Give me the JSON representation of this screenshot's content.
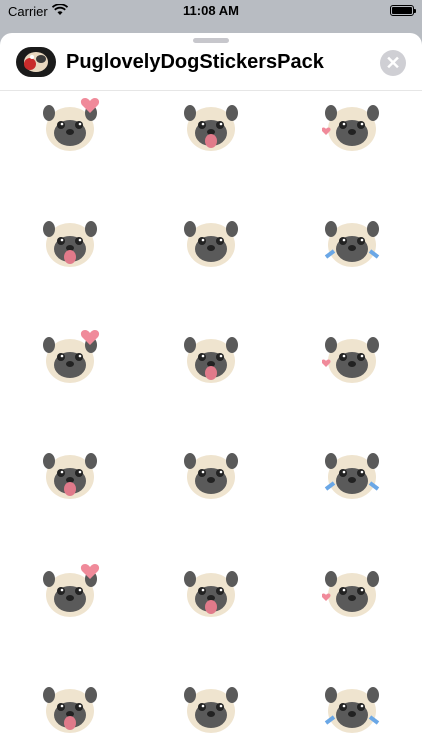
{
  "status": {
    "carrier": "Carrier",
    "time": "11:08 AM"
  },
  "header": {
    "title": "PuglovelyDogStickersPack",
    "close_icon": "close-icon",
    "app_icon": "pug-sticker-app-icon"
  },
  "stickers": [
    {
      "name": "pug-heart-sticker"
    },
    {
      "name": "pug-face-sticker"
    },
    {
      "name": "pug-sleepy-sticker"
    },
    {
      "name": "pug-peek-sticker"
    },
    {
      "name": "pug-laugh-sticker"
    },
    {
      "name": "pug-hearts-sticker"
    },
    {
      "name": "pug-love-eyes-sticker"
    },
    {
      "name": "pug-happy-sticker"
    },
    {
      "name": "pug-grin-sticker"
    },
    {
      "name": "pug-cartoon-sticker"
    },
    {
      "name": "pug-sad-sticker"
    },
    {
      "name": "pug-crying-sticker"
    },
    {
      "name": "pug-tongue-sticker"
    },
    {
      "name": "pug-scared-sticker"
    },
    {
      "name": "pug-wink-sticker"
    },
    {
      "name": "pug-door-sticker"
    },
    {
      "name": "pug-sweat-sticker"
    },
    {
      "name": "pug-tear-sticker"
    }
  ]
}
